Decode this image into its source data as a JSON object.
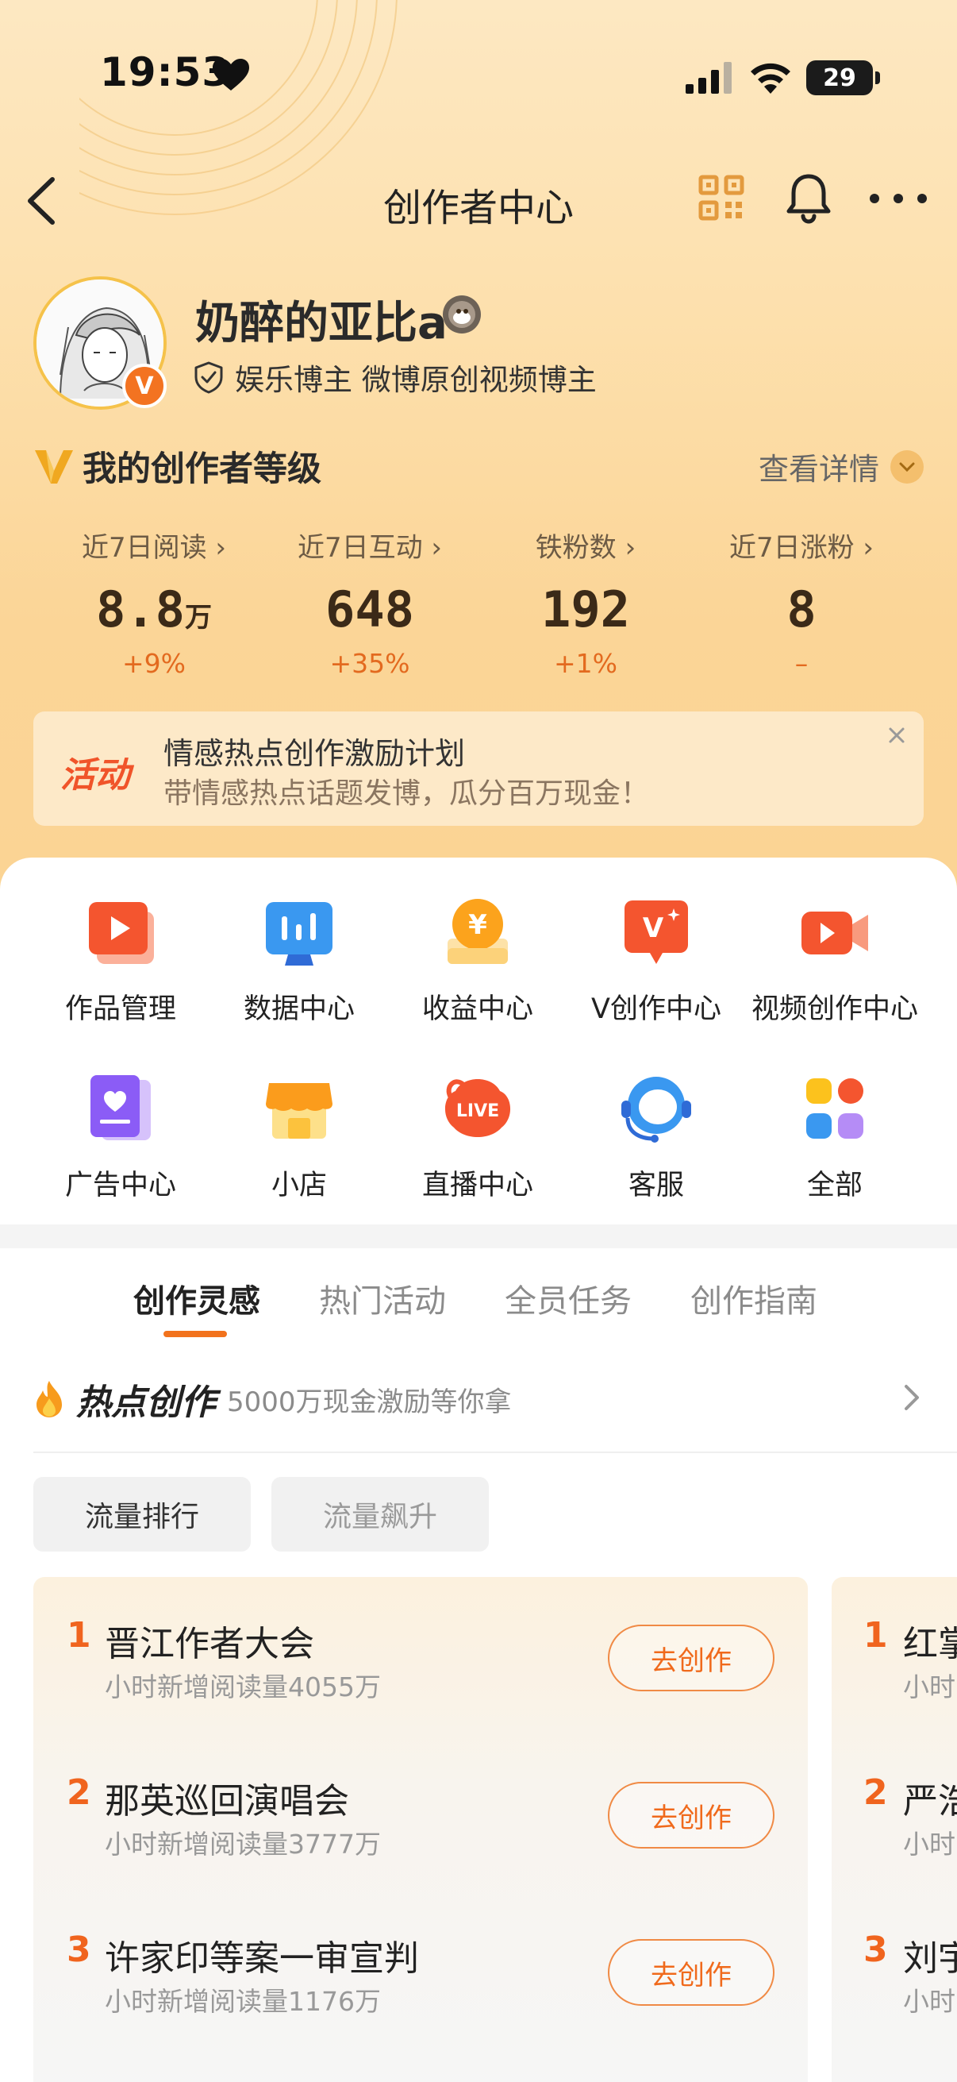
{
  "status_bar": {
    "time": "19:53",
    "battery": "29"
  },
  "nav": {
    "title": "创作者中心"
  },
  "profile": {
    "name": "奶醉的亚比a",
    "verify_text": "娱乐博主 微博原创视频博主",
    "avatar_badge": "V"
  },
  "level": {
    "title": "我的创作者等级",
    "detail": "查看详情"
  },
  "stats": [
    {
      "label": "近7日阅读 ›",
      "value": "8.8",
      "unit": "万",
      "change": "+9%"
    },
    {
      "label": "近7日互动 ›",
      "value": "648",
      "unit": "",
      "change": "+35%"
    },
    {
      "label": "铁粉数 ›",
      "value": "192",
      "unit": "",
      "change": "+1%"
    },
    {
      "label": "近7日涨粉 ›",
      "value": "8",
      "unit": "",
      "change": "–"
    }
  ],
  "activity": {
    "tag": "活动",
    "title": "情感热点创作激励计划",
    "subtitle": "带情感热点话题发博，瓜分百万现金！"
  },
  "tools": [
    {
      "label": "作品管理",
      "icon": "works-manage-icon"
    },
    {
      "label": "数据中心",
      "icon": "data-center-icon"
    },
    {
      "label": "收益中心",
      "icon": "income-center-icon"
    },
    {
      "label": "V创作中心",
      "icon": "v-creation-icon"
    },
    {
      "label": "视频创作中心",
      "icon": "video-creation-icon"
    },
    {
      "label": "广告中心",
      "icon": "ad-center-icon"
    },
    {
      "label": "小店",
      "icon": "shop-icon"
    },
    {
      "label": "直播中心",
      "icon": "live-center-icon"
    },
    {
      "label": "客服",
      "icon": "customer-service-icon"
    },
    {
      "label": "全部",
      "icon": "all-apps-icon"
    }
  ],
  "tabs": [
    {
      "label": "创作灵感",
      "active": true
    },
    {
      "label": "热门活动",
      "active": false
    },
    {
      "label": "全员任务",
      "active": false
    },
    {
      "label": "创作指南",
      "active": false
    }
  ],
  "hot": {
    "title": "热点创作",
    "subtitle": "5000万现金激励等你拿"
  },
  "chips": [
    {
      "label": "流量排行",
      "active": true
    },
    {
      "label": "流量飙升",
      "active": false
    }
  ],
  "rank_lists": [
    {
      "items": [
        {
          "num": "1",
          "title": "晋江作者大会",
          "sub": "小时新增阅读量4055万",
          "button": "去创作"
        },
        {
          "num": "2",
          "title": "那英巡回演唱会",
          "sub": "小时新增阅读量3777万",
          "button": "去创作"
        },
        {
          "num": "3",
          "title": "许家印等案一审宣判",
          "sub": "小时新增阅读量1176万",
          "button": "去创作"
        }
      ]
    },
    {
      "items": [
        {
          "num": "1",
          "title": "红掌",
          "sub": "小时"
        },
        {
          "num": "2",
          "title": "严浩",
          "sub": "小时"
        },
        {
          "num": "3",
          "title": "刘宇",
          "sub": "小时"
        }
      ]
    }
  ]
}
